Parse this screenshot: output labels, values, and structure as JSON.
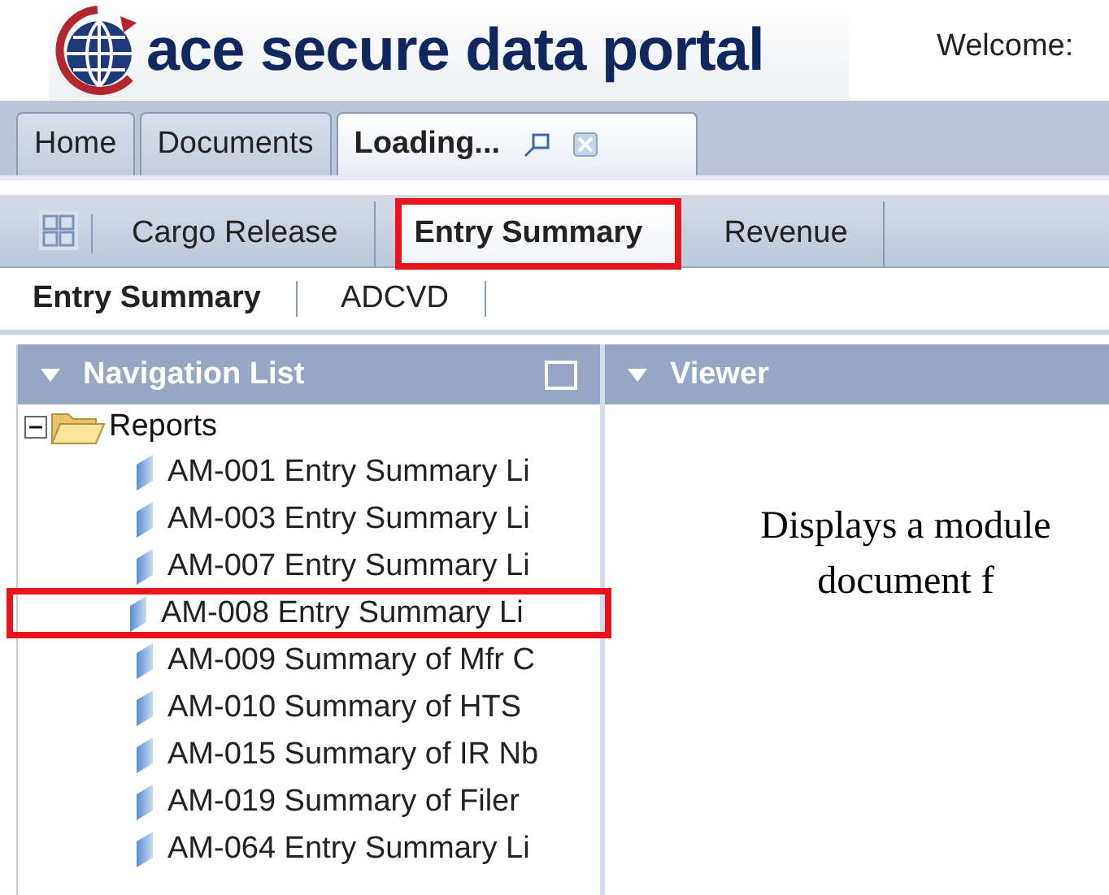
{
  "header": {
    "logo_text": "ace secure data portal",
    "welcome": "Welcome:"
  },
  "top_tabs": [
    {
      "label": "Home",
      "selected": false
    },
    {
      "label": "Documents",
      "selected": false
    },
    {
      "label": "Loading...",
      "selected": true
    }
  ],
  "module_tabs": [
    {
      "label": "Cargo Release",
      "selected": false,
      "highlighted": false
    },
    {
      "label": "Entry Summary",
      "selected": true,
      "highlighted": true
    },
    {
      "label": "Revenue",
      "selected": false,
      "highlighted": false
    }
  ],
  "sub_tabs": [
    {
      "label": "Entry Summary",
      "selected": true
    },
    {
      "label": "ADCVD",
      "selected": false
    }
  ],
  "navigation_list": {
    "title": "Navigation List",
    "tree": [
      {
        "label": "Reports",
        "expanded": true,
        "children": [
          {
            "label": "AM-001 Entry Summary Li",
            "highlighted": false
          },
          {
            "label": "AM-003 Entry Summary Li",
            "highlighted": false
          },
          {
            "label": "AM-007 Entry Summary Li",
            "highlighted": false
          },
          {
            "label": "AM-008 Entry Summary Li",
            "highlighted": true
          },
          {
            "label": "AM-009 Summary of Mfr C",
            "highlighted": false
          },
          {
            "label": "AM-010 Summary of HTS",
            "highlighted": false
          },
          {
            "label": "AM-015 Summary of IR Nb",
            "highlighted": false
          },
          {
            "label": "AM-019 Summary of Filer",
            "highlighted": false
          },
          {
            "label": "AM-064 Entry Summary Li",
            "highlighted": false
          }
        ]
      }
    ]
  },
  "viewer": {
    "title": "Viewer",
    "lines": [
      "Displays a module",
      "document f"
    ]
  }
}
